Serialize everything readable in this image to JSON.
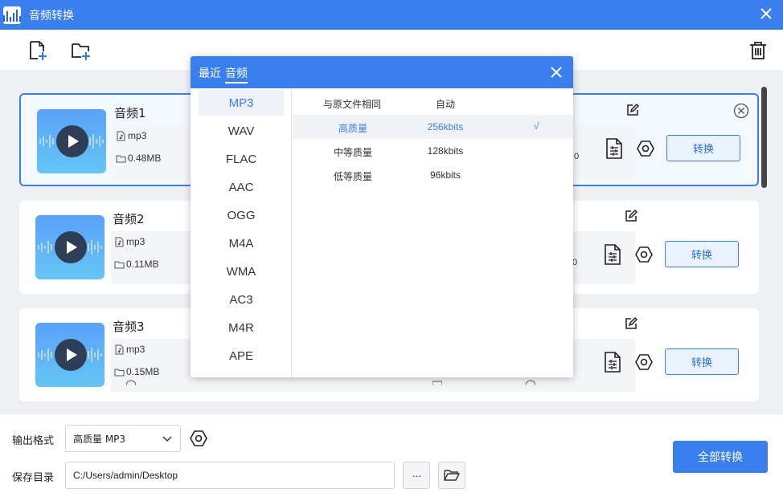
{
  "app": {
    "title": "音频转换"
  },
  "toolbar": {
    "add_file_icon": "add-file-icon",
    "add_folder_icon": "add-folder-icon",
    "delete_icon": "trash-icon"
  },
  "files": [
    {
      "name": "音频1",
      "format": "mp3",
      "size": "0.48MB",
      "frag": "0",
      "selected": true
    },
    {
      "name": "音频2",
      "format": "mp3",
      "size": "0.11MB",
      "frag": "0",
      "selected": false
    },
    {
      "name": "音频3",
      "format": "mp3",
      "size": "0.15MB",
      "frag": "0",
      "selected": false
    }
  ],
  "card_labels": {
    "convert": "转换"
  },
  "bottom": {
    "output_format_label": "输出格式",
    "output_format_value": "高质量 MP3",
    "save_dir_label": "保存目录",
    "save_dir_value": "C:/Users/admin/Desktop",
    "browse_label": "···",
    "convert_all": "全部转换"
  },
  "popup": {
    "tabs": [
      "最近",
      "音频"
    ],
    "active_tab": "音频",
    "formats": [
      "MP3",
      "WAV",
      "FLAC",
      "AAC",
      "OGG",
      "M4A",
      "WMA",
      "AC3",
      "M4R",
      "APE"
    ],
    "active_format": "MP3",
    "header": {
      "name": "与原文件相同",
      "rate": "自动"
    },
    "qualities": [
      {
        "name": "高质量",
        "rate": "256kbits",
        "check": "√",
        "active": true
      },
      {
        "name": "中等质量",
        "rate": "128kbits",
        "check": "",
        "active": false
      },
      {
        "name": "低等质量",
        "rate": "96kbits",
        "check": "",
        "active": false
      }
    ]
  },
  "colors": {
    "accent": "#3a7ff0",
    "content_bg": "#eef0f4",
    "thumb_top": "#5aa2f8",
    "thumb_bottom": "#66c5f5"
  }
}
